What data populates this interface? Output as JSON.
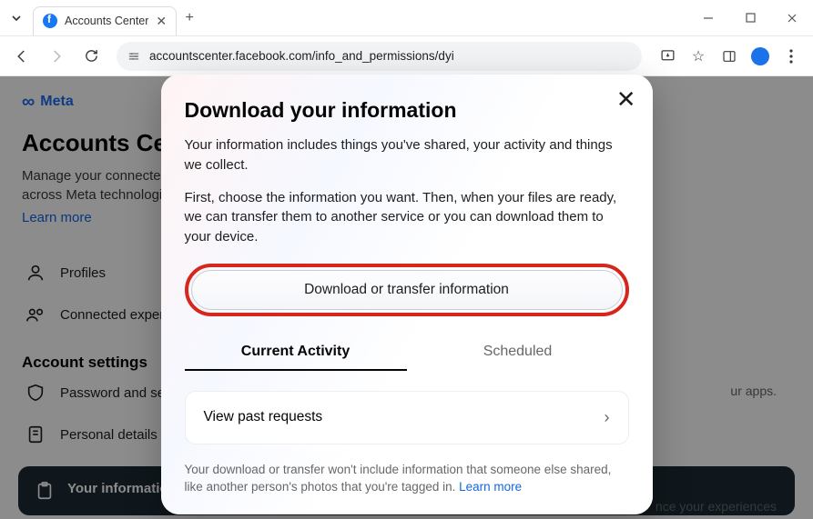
{
  "window": {
    "tab_title": "Accounts Center",
    "url": "accountscenter.facebook.com/info_and_permissions/dyi"
  },
  "page": {
    "brand": "Meta",
    "title": "Accounts Center",
    "description": "Manage your connected experiences and account settings across Meta technologies like Facebook, Instagram and more.",
    "learn_more": "Learn more",
    "side_profiles": "Profiles",
    "side_connected": "Connected experiences",
    "section_account_settings": "Account settings",
    "side_password": "Password and security",
    "side_personal": "Personal details",
    "selected_side": "Your information and permissions",
    "hint_apps": "ur apps.",
    "hint_exp": "nce your experiences"
  },
  "modal": {
    "title": "Download your information",
    "p1": "Your information includes things you've shared, your activity and things we collect.",
    "p2": "First, choose the information you want. Then, when your files are ready, we can transfer them to another service or you can download them to your device.",
    "cta": "Download or transfer information",
    "tab_current": "Current Activity",
    "tab_scheduled": "Scheduled",
    "past_requests": "View past requests",
    "disclaimer": "Your download or transfer won't include information that someone else shared, like another person's photos that you're tagged in. ",
    "disclaimer_link": "Learn more"
  }
}
